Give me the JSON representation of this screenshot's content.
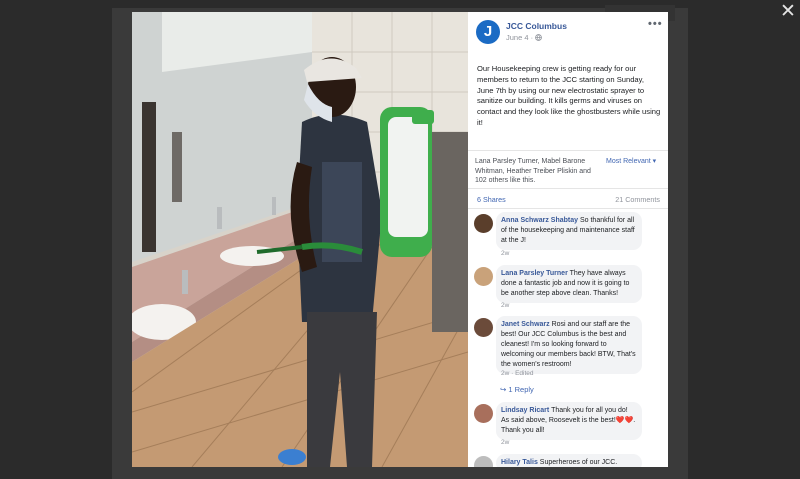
{
  "lightbox": {
    "close_glyph": "✕"
  },
  "post": {
    "page_name": "JCC Columbus",
    "avatar_letter": "J",
    "date": "June 4 · ",
    "privacy_icon": "globe-icon",
    "more_glyph": "•••",
    "text": "Our Housekeeping crew is getting ready for our members to return to the JCC starting on Sunday, June 7th by using our new electrostatic sprayer to sanitize our building. It kills germs and viruses on contact and they look like the ghostbusters while using it!",
    "likes_text": "Lana Parsley Turner, Mabel Barone Whitman, Heather Treiber Pliskin and 102 others like this.",
    "sort_label": "Most Relevant ▾",
    "shares": "6 Shares",
    "comments_count": "21 Comments"
  },
  "comments": [
    {
      "name": "Anna Schwarz Shabtay",
      "text": "So thankful for all of the housekeeping and maintenance staff at the J!",
      "time": "2w",
      "avatar_color": "#5a3e2b"
    },
    {
      "name": "Lana Parsley Turner",
      "text": "They have always done a fantastic job and now it is going to be another step above clean. Thanks!",
      "time": "2w",
      "avatar_color": "#c9a27a"
    },
    {
      "name": "Janet Schwarz",
      "text": "Rosi and our staff are the best! Our JCC Columbus is the best and cleanest! I'm so looking forward to welcoming our members back! BTW, That's the women's restroom!",
      "time": "2w · Edited",
      "avatar_color": "#6b4b3a"
    },
    {
      "name": "Lindsay Ricart",
      "text": "Thank you for all you do! As said above, Roosevelt is the best!❤️❤️. Thank you all!",
      "time": "2w",
      "avatar_color": "#a86f5c"
    },
    {
      "name": "Hilary Talis",
      "text": "Superheroes of our JCC.",
      "time": "",
      "avatar_color": "#bdbdbd"
    }
  ],
  "reply": {
    "label": "↪ 1 Reply"
  },
  "colors": {
    "link": "#385898",
    "accent": "#4267b2",
    "bubble": "#f2f3f5",
    "sprayer_green": "#2fa14a"
  }
}
